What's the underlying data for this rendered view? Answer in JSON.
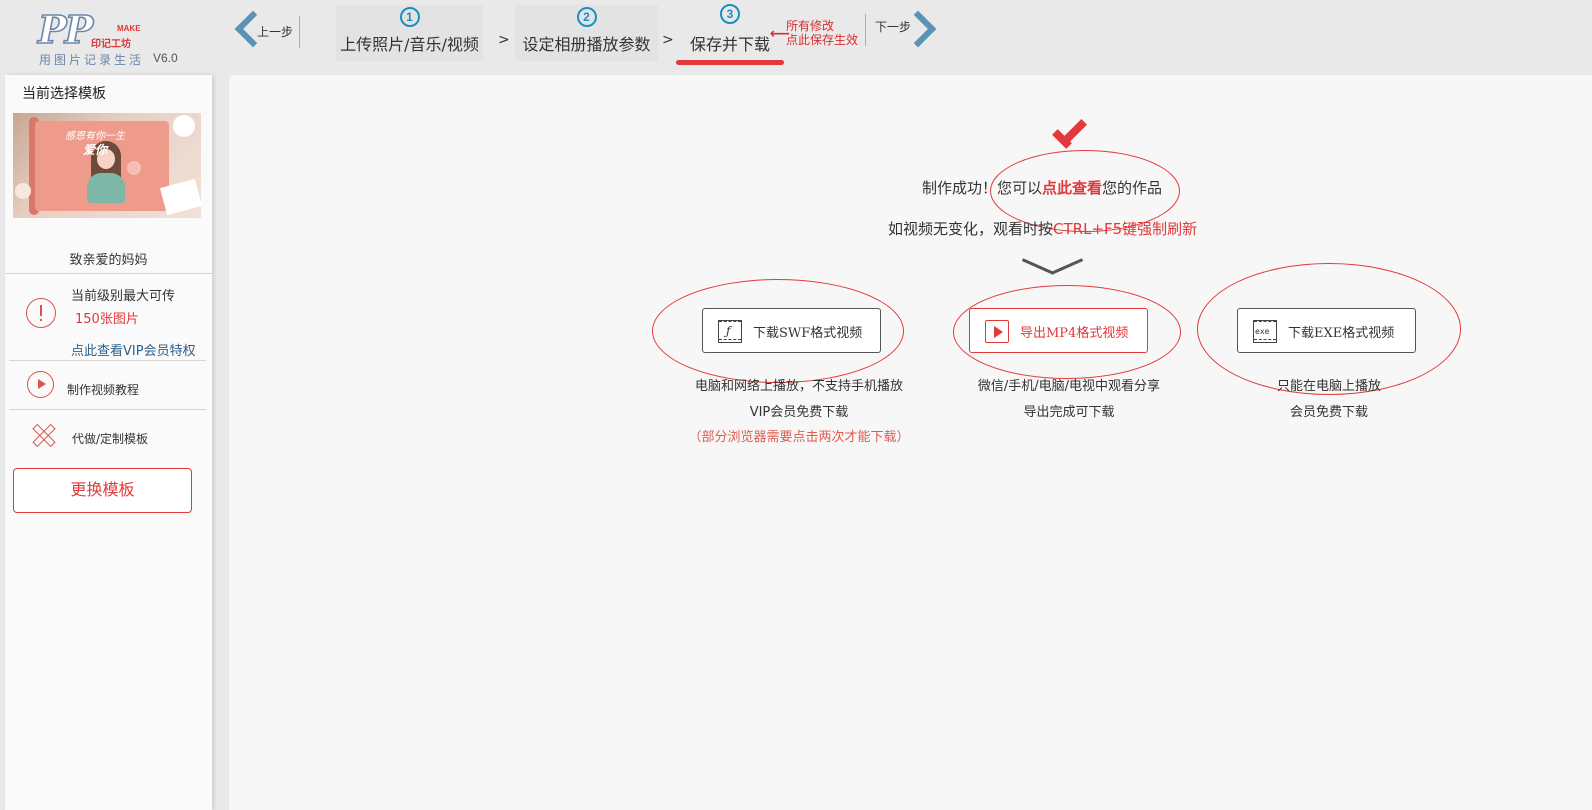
{
  "header": {
    "logo": {
      "mark": "PP",
      "make": "MAKE",
      "brand_cn": "印记工坊",
      "slogan": "用图片记录生活",
      "version": "V6.0"
    },
    "prev_label": "上一步",
    "next_label": "下一步",
    "steps": [
      {
        "num": "1",
        "label": "上传照片/音乐/视频"
      },
      {
        "num": "2",
        "label": "设定相册播放参数"
      },
      {
        "num": "3",
        "label": "保存并下载",
        "active": true
      }
    ],
    "separator": ">",
    "save_hint_line1": "所有修改",
    "save_hint_line2": "点此保存生效",
    "accent": "#e2393b",
    "nav_blue": "#5a93b6"
  },
  "sidebar": {
    "title": "当前选择模板",
    "thumb_title_1": "感恩有你一生",
    "thumb_title_2": "爱你",
    "template_name": "致亲爱的妈妈",
    "level_line1": "当前级别最大可传",
    "level_line2": "150张图片",
    "vip_link": "点此查看VIP会员特权",
    "tutorial": "制作视频教程",
    "custom": "代做/定制模板",
    "change_button": "更换模板"
  },
  "main": {
    "success_prefix": "制作成功！您可以",
    "success_link": "点此查看",
    "success_suffix": "您的作品",
    "refresh_prefix": "如视频无变化，观看时按",
    "refresh_key": "CTRL+F5键强制刷新",
    "downloads": [
      {
        "label": "下载SWF格式视频",
        "icon": "flash-film-icon",
        "desc1": "电脑和网络上播放，不支持手机播放",
        "desc2": "VIP会员免费下载",
        "desc3": "（部分浏览器需要点击两次才能下载）"
      },
      {
        "label": "导出MP4格式视频",
        "icon": "play-film-icon",
        "desc1": "微信/手机/电脑/电视中观看分享",
        "desc2": "导出完成可下载"
      },
      {
        "label": "下载EXE格式视频",
        "icon": "exe-film-icon",
        "desc1": "只能在电脑上播放",
        "desc2": "会员免费下载"
      }
    ]
  }
}
